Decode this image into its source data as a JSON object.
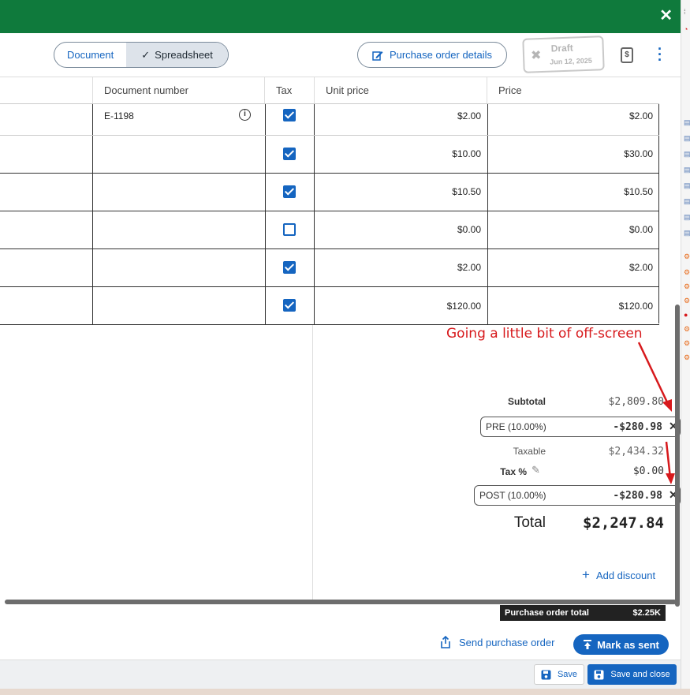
{
  "toolbar": {
    "seg_document": "Document",
    "seg_spreadsheet": "Spreadsheet",
    "po_details": "Purchase order details",
    "draft_label": "Draft",
    "draft_date": "Jun 12, 2025",
    "dollar_icon_text": "$"
  },
  "table": {
    "headers": {
      "document_number": "Document number",
      "tax": "Tax",
      "unit_price": "Unit price",
      "price": "Price"
    },
    "rows": [
      {
        "document_number": "E-1198",
        "tax": true,
        "unit_price": "$2.00",
        "price": "$2.00"
      },
      {
        "document_number": "",
        "tax": true,
        "unit_price": "$10.00",
        "price": "$30.00"
      },
      {
        "document_number": "",
        "tax": true,
        "unit_price": "$10.50",
        "price": "$10.50"
      },
      {
        "document_number": "",
        "tax": false,
        "unit_price": "$0.00",
        "price": "$0.00"
      },
      {
        "document_number": "",
        "tax": true,
        "unit_price": "$2.00",
        "price": "$2.00"
      },
      {
        "document_number": "",
        "tax": true,
        "unit_price": "$120.00",
        "price": "$120.00"
      }
    ]
  },
  "annotation": "Going a little bit of off-screen",
  "totals": {
    "subtotal_label": "Subtotal",
    "subtotal_value": "$2,809.80",
    "pre_discount_label": "PRE (10.00%)",
    "pre_discount_value": "-$280.98",
    "taxable_label": "Taxable",
    "taxable_value": "$2,434.32",
    "tax_label": "Tax %",
    "tax_value": "$0.00",
    "post_discount_label": "POST (10.00%)",
    "post_discount_value": "-$280.98",
    "total_label": "Total",
    "total_value": "$2,247.84",
    "add_discount": "Add discount"
  },
  "po_total": {
    "label": "Purchase order total",
    "value": "$2.25K"
  },
  "actions": {
    "send": "Send purchase order",
    "mark_sent": "Mark as sent",
    "save": "Save",
    "save_close": "Save and close"
  },
  "colors": {
    "header_green": "#0f7a3c",
    "primary_blue": "#1565c0",
    "annotation_red": "#d7191c"
  }
}
